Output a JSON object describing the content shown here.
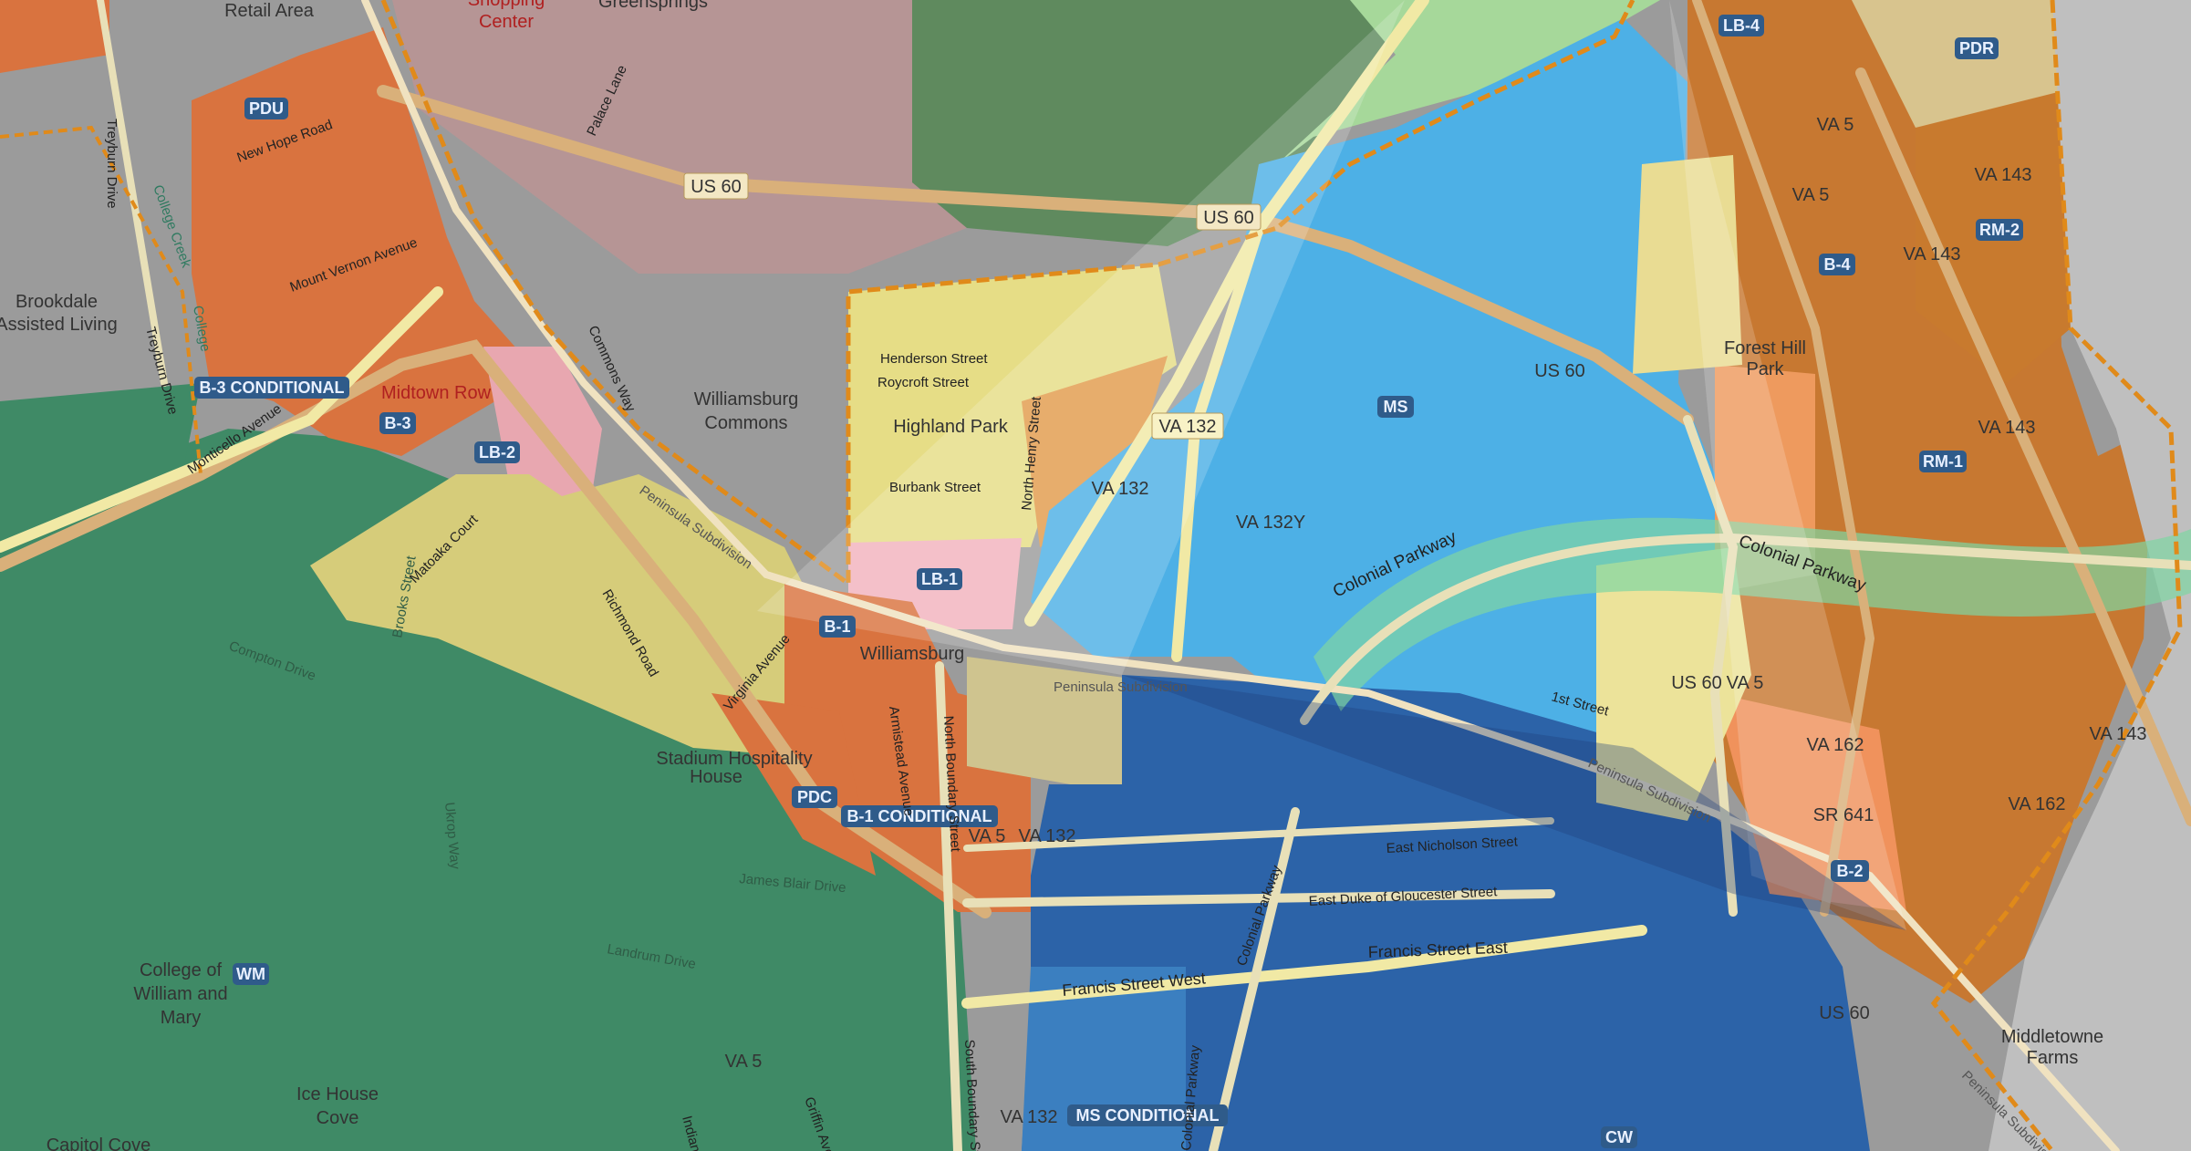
{
  "map": {
    "colors": {
      "background_gray": "#9a9a9a",
      "green_wm": "#3f8a66",
      "orange_b": "#d9733f",
      "yellow_residential": "#d6cc7a",
      "pink_lb": "#e8a7b0",
      "blue_ms": "#4db0e6",
      "dark_blue_cw": "#2c63a8",
      "light_green_park": "#a6d89a",
      "gray_map": "#9b9b9b",
      "boundary_orange": "#e08a1a"
    },
    "zone_labels": [
      {
        "id": "pdu",
        "text": "PDU"
      },
      {
        "id": "b3cond",
        "text": "B-3 CONDITIONAL"
      },
      {
        "id": "b3",
        "text": "B-3"
      },
      {
        "id": "lb2",
        "text": "LB-2"
      },
      {
        "id": "lb1",
        "text": "LB-1"
      },
      {
        "id": "b1",
        "text": "B-1"
      },
      {
        "id": "pdc",
        "text": "PDC"
      },
      {
        "id": "b1cond",
        "text": "B-1 CONDITIONAL"
      },
      {
        "id": "wm",
        "text": "WM"
      },
      {
        "id": "ms",
        "text": "MS"
      },
      {
        "id": "mscond",
        "text": "MS CONDITIONAL"
      },
      {
        "id": "cw",
        "text": "CW"
      },
      {
        "id": "lb4",
        "text": "LB-4"
      },
      {
        "id": "pdr",
        "text": "PDR"
      },
      {
        "id": "b4",
        "text": "B-4"
      },
      {
        "id": "rm2",
        "text": "RM-2"
      },
      {
        "id": "rm1",
        "text": "RM-1"
      },
      {
        "id": "b2",
        "text": "B-2"
      }
    ],
    "route_shields": [
      {
        "id": "us60a",
        "text": "US 60"
      },
      {
        "id": "us60b",
        "text": "US 60"
      },
      {
        "id": "us60c",
        "text": "US 60"
      },
      {
        "id": "us60d",
        "text": "US 60"
      },
      {
        "id": "us60e",
        "text": "US 60"
      },
      {
        "id": "va132a",
        "text": "VA 132"
      },
      {
        "id": "va132b",
        "text": "VA 132"
      },
      {
        "id": "va132y",
        "text": "VA 132Y"
      },
      {
        "id": "va132c",
        "text": "VA 132"
      },
      {
        "id": "va132d",
        "text": "VA 132"
      },
      {
        "id": "va5a",
        "text": "VA 5"
      },
      {
        "id": "va5b",
        "text": "VA 5"
      },
      {
        "id": "va5c",
        "text": "VA 5"
      },
      {
        "id": "va5d",
        "text": "VA 5"
      },
      {
        "id": "va5e",
        "text": "VA 5"
      },
      {
        "id": "va143a",
        "text": "VA 143"
      },
      {
        "id": "va143b",
        "text": "VA 143"
      },
      {
        "id": "va143c",
        "text": "VA 143"
      },
      {
        "id": "va143d",
        "text": "VA 143"
      },
      {
        "id": "va162a",
        "text": "VA 162"
      },
      {
        "id": "va162b",
        "text": "VA 162"
      },
      {
        "id": "sr641",
        "text": "SR 641"
      }
    ],
    "place_labels": [
      {
        "id": "retail",
        "text": "Retail Area"
      },
      {
        "id": "shopping",
        "text": "Shopping"
      },
      {
        "id": "center",
        "text": "Center"
      },
      {
        "id": "greensprings",
        "text": "Greensprings"
      },
      {
        "id": "brookdale1",
        "text": "Brookdale"
      },
      {
        "id": "brookdale2",
        "text": "Assisted Living"
      },
      {
        "id": "midtown",
        "text": "Midtown Row"
      },
      {
        "id": "wc1",
        "text": "Williamsburg"
      },
      {
        "id": "wc2",
        "text": "Commons"
      },
      {
        "id": "highland",
        "text": "Highland Park"
      },
      {
        "id": "williamsburg",
        "text": "Williamsburg"
      },
      {
        "id": "stadium",
        "text": "Stadium Hospitality"
      },
      {
        "id": "house",
        "text": "House"
      },
      {
        "id": "college1",
        "text": "College of"
      },
      {
        "id": "college2",
        "text": "William and"
      },
      {
        "id": "college3",
        "text": "Mary"
      },
      {
        "id": "ice1",
        "text": "Ice House"
      },
      {
        "id": "ice2",
        "text": "Cove"
      },
      {
        "id": "capitol",
        "text": "Capitol Cove"
      },
      {
        "id": "forest1",
        "text": "Forest Hill"
      },
      {
        "id": "forest2",
        "text": "Park"
      },
      {
        "id": "middle1",
        "text": "Middletowne"
      },
      {
        "id": "middle2",
        "text": "Farms"
      }
    ],
    "street_labels": [
      {
        "id": "newhope",
        "text": "New Hope Road"
      },
      {
        "id": "mtvernon",
        "text": "Mount Vernon Avenue"
      },
      {
        "id": "treyburn",
        "text": "Treyburn Drive"
      },
      {
        "id": "treyburn2",
        "text": "Treyburn Drive"
      },
      {
        "id": "collegecreek",
        "text": "College Creek"
      },
      {
        "id": "college",
        "text": "College"
      },
      {
        "id": "monticello",
        "text": "Monticello Avenue"
      },
      {
        "id": "palace",
        "text": "Palace Lane"
      },
      {
        "id": "commonsway",
        "text": "Commons Way"
      },
      {
        "id": "henderson",
        "text": "Henderson Street"
      },
      {
        "id": "roycroft",
        "text": "Roycroft Street"
      },
      {
        "id": "burbank",
        "text": "Burbank Street"
      },
      {
        "id": "northhenry",
        "text": "North Henry Street"
      },
      {
        "id": "matoaka",
        "text": "Matoaka Court"
      },
      {
        "id": "richmond",
        "text": "Richmond Road"
      },
      {
        "id": "virginia",
        "text": "Virginia Avenue"
      },
      {
        "id": "brooks",
        "text": "Brooks Street"
      },
      {
        "id": "compton",
        "text": "Compton Drive"
      },
      {
        "id": "ukrop",
        "text": "Ukrop Way"
      },
      {
        "id": "jamesblair",
        "text": "James Blair Drive"
      },
      {
        "id": "landrum",
        "text": "Landrum Drive"
      },
      {
        "id": "armistead",
        "text": "Armistead Avenue"
      },
      {
        "id": "northboundary",
        "text": "North Boundary Street"
      },
      {
        "id": "southboundary",
        "text": "South Boundary Street"
      },
      {
        "id": "colonialpkwy1",
        "text": "Colonial Parkway"
      },
      {
        "id": "colonialpkwy2",
        "text": "Colonial Parkway"
      },
      {
        "id": "colonialpkwy3",
        "text": "Colonial Parkway"
      },
      {
        "id": "colonialpkwy4",
        "text": "Colonial Parkway"
      },
      {
        "id": "penn1",
        "text": "Peninsula Subdivision"
      },
      {
        "id": "penn2",
        "text": "Peninsula Subdivision"
      },
      {
        "id": "penn3",
        "text": "Peninsula Subdivision"
      },
      {
        "id": "penn4",
        "text": "Peninsula Subdivision"
      },
      {
        "id": "firststreet",
        "text": "1st Street"
      },
      {
        "id": "nicholson",
        "text": "East Nicholson Street"
      },
      {
        "id": "gloucester",
        "text": "East Duke of Gloucester Street"
      },
      {
        "id": "franciseast",
        "text": "Francis Street East"
      },
      {
        "id": "franciswest",
        "text": "Francis Street West"
      },
      {
        "id": "indian",
        "text": "Indian Springs"
      },
      {
        "id": "griffin",
        "text": "Griffin Avenue"
      }
    ]
  }
}
